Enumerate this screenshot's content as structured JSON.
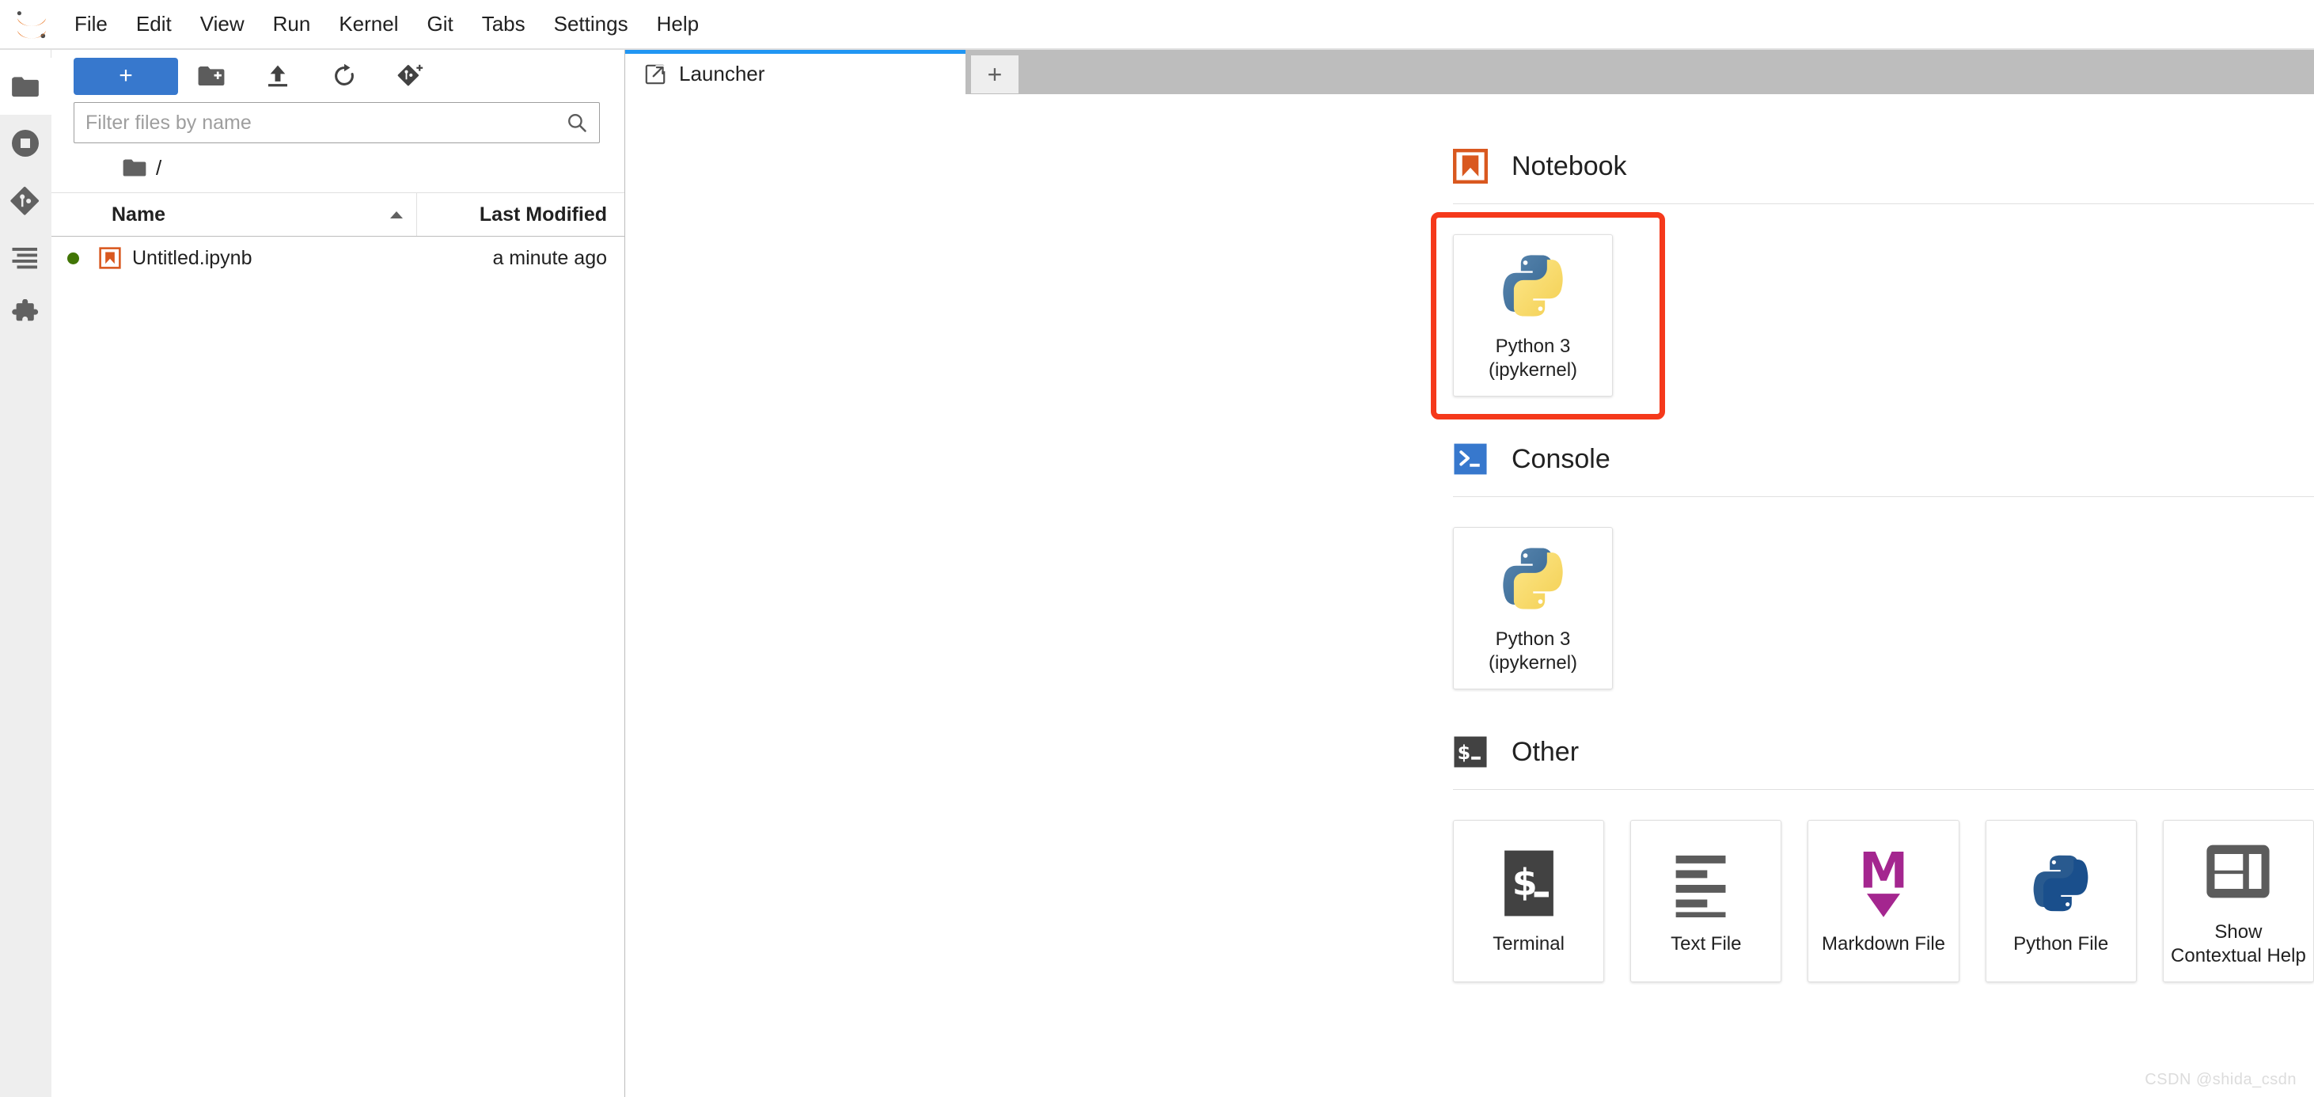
{
  "app": {
    "title": "JupyterLab",
    "logo_icon": "jupyter-logo-icon",
    "watermark": "CSDN @shida_csdn"
  },
  "menubar": {
    "items": [
      {
        "label": "File"
      },
      {
        "label": "Edit"
      },
      {
        "label": "View"
      },
      {
        "label": "Run"
      },
      {
        "label": "Kernel"
      },
      {
        "label": "Git"
      },
      {
        "label": "Tabs"
      },
      {
        "label": "Settings"
      },
      {
        "label": "Help"
      }
    ]
  },
  "activity_bar": {
    "items": [
      {
        "name": "file-browser",
        "icon": "folder-icon",
        "selected": true
      },
      {
        "name": "running-terminals-kernels",
        "icon": "stop-circle-icon",
        "selected": false
      },
      {
        "name": "git",
        "icon": "git-icon",
        "selected": false
      },
      {
        "name": "table-of-contents",
        "icon": "list-icon",
        "selected": false
      },
      {
        "name": "extension-manager",
        "icon": "puzzle-icon",
        "selected": false
      }
    ]
  },
  "file_browser": {
    "toolbar": {
      "new_launcher_label": "+",
      "new_folder_icon": "new-folder-icon",
      "upload_icon": "upload-icon",
      "refresh_icon": "refresh-icon",
      "git_clone_icon": "git-clone-icon"
    },
    "filter": {
      "value": "",
      "placeholder": "Filter files by name",
      "search_icon": "search-icon"
    },
    "breadcrumb": {
      "root_icon": "folder-icon",
      "path": "/"
    },
    "columns": {
      "name": "Name",
      "last_modified": "Last Modified",
      "sort_icon": "sort-ascending-icon"
    },
    "rows": [
      {
        "name": "Untitled.ipynb",
        "last_modified": "a minute ago",
        "icon": "notebook-icon",
        "running": true,
        "running_color": "#417505"
      }
    ]
  },
  "dock": {
    "tabs": [
      {
        "label": "Launcher",
        "icon": "launcher-icon",
        "active": true
      }
    ],
    "add_tab_label": "+"
  },
  "launcher": {
    "sections": [
      {
        "id": "notebook",
        "title": "Notebook",
        "icon": "notebook-bookmark-icon",
        "icon_color": "#d9581f",
        "cards": [
          {
            "label": "Python 3\n(ipykernel)",
            "label_line1": "Python 3",
            "label_line2": "(ipykernel)",
            "icon": "python-logo-icon",
            "highlighted": true
          }
        ]
      },
      {
        "id": "console",
        "title": "Console",
        "icon": "console-prompt-icon",
        "icon_color": "#3778cd",
        "cards": [
          {
            "label": "Python 3\n(ipykernel)",
            "label_line1": "Python 3",
            "label_line2": "(ipykernel)",
            "icon": "python-logo-icon",
            "highlighted": false
          }
        ]
      },
      {
        "id": "other",
        "title": "Other",
        "icon": "terminal-dollar-icon",
        "icon_color": "#424242",
        "cards": [
          {
            "label": "Terminal",
            "label_line1": "Terminal",
            "label_line2": "",
            "icon": "terminal-icon",
            "highlighted": false
          },
          {
            "label": "Text File",
            "label_line1": "Text File",
            "label_line2": "",
            "icon": "text-file-icon",
            "highlighted": false
          },
          {
            "label": "Markdown File",
            "label_line1": "Markdown File",
            "label_line2": "",
            "icon": "markdown-icon",
            "highlighted": false
          },
          {
            "label": "Python File",
            "label_line1": "Python File",
            "label_line2": "",
            "icon": "python-file-icon",
            "highlighted": false
          },
          {
            "label": "Show Contextual Help",
            "label_line1": "Show",
            "label_line2": "Contextual Help",
            "icon": "contextual-help-icon",
            "highlighted": false
          }
        ]
      }
    ]
  },
  "colors": {
    "accent_blue": "#3778cd",
    "tab_active_border": "#2196f3",
    "notebook_orange": "#d9581f",
    "markdown_purple": "#a4268f",
    "python_blue": "#3572a5",
    "python_yellow": "#f7d558",
    "highlight_red": "#f5391b",
    "running_green": "#417505"
  }
}
